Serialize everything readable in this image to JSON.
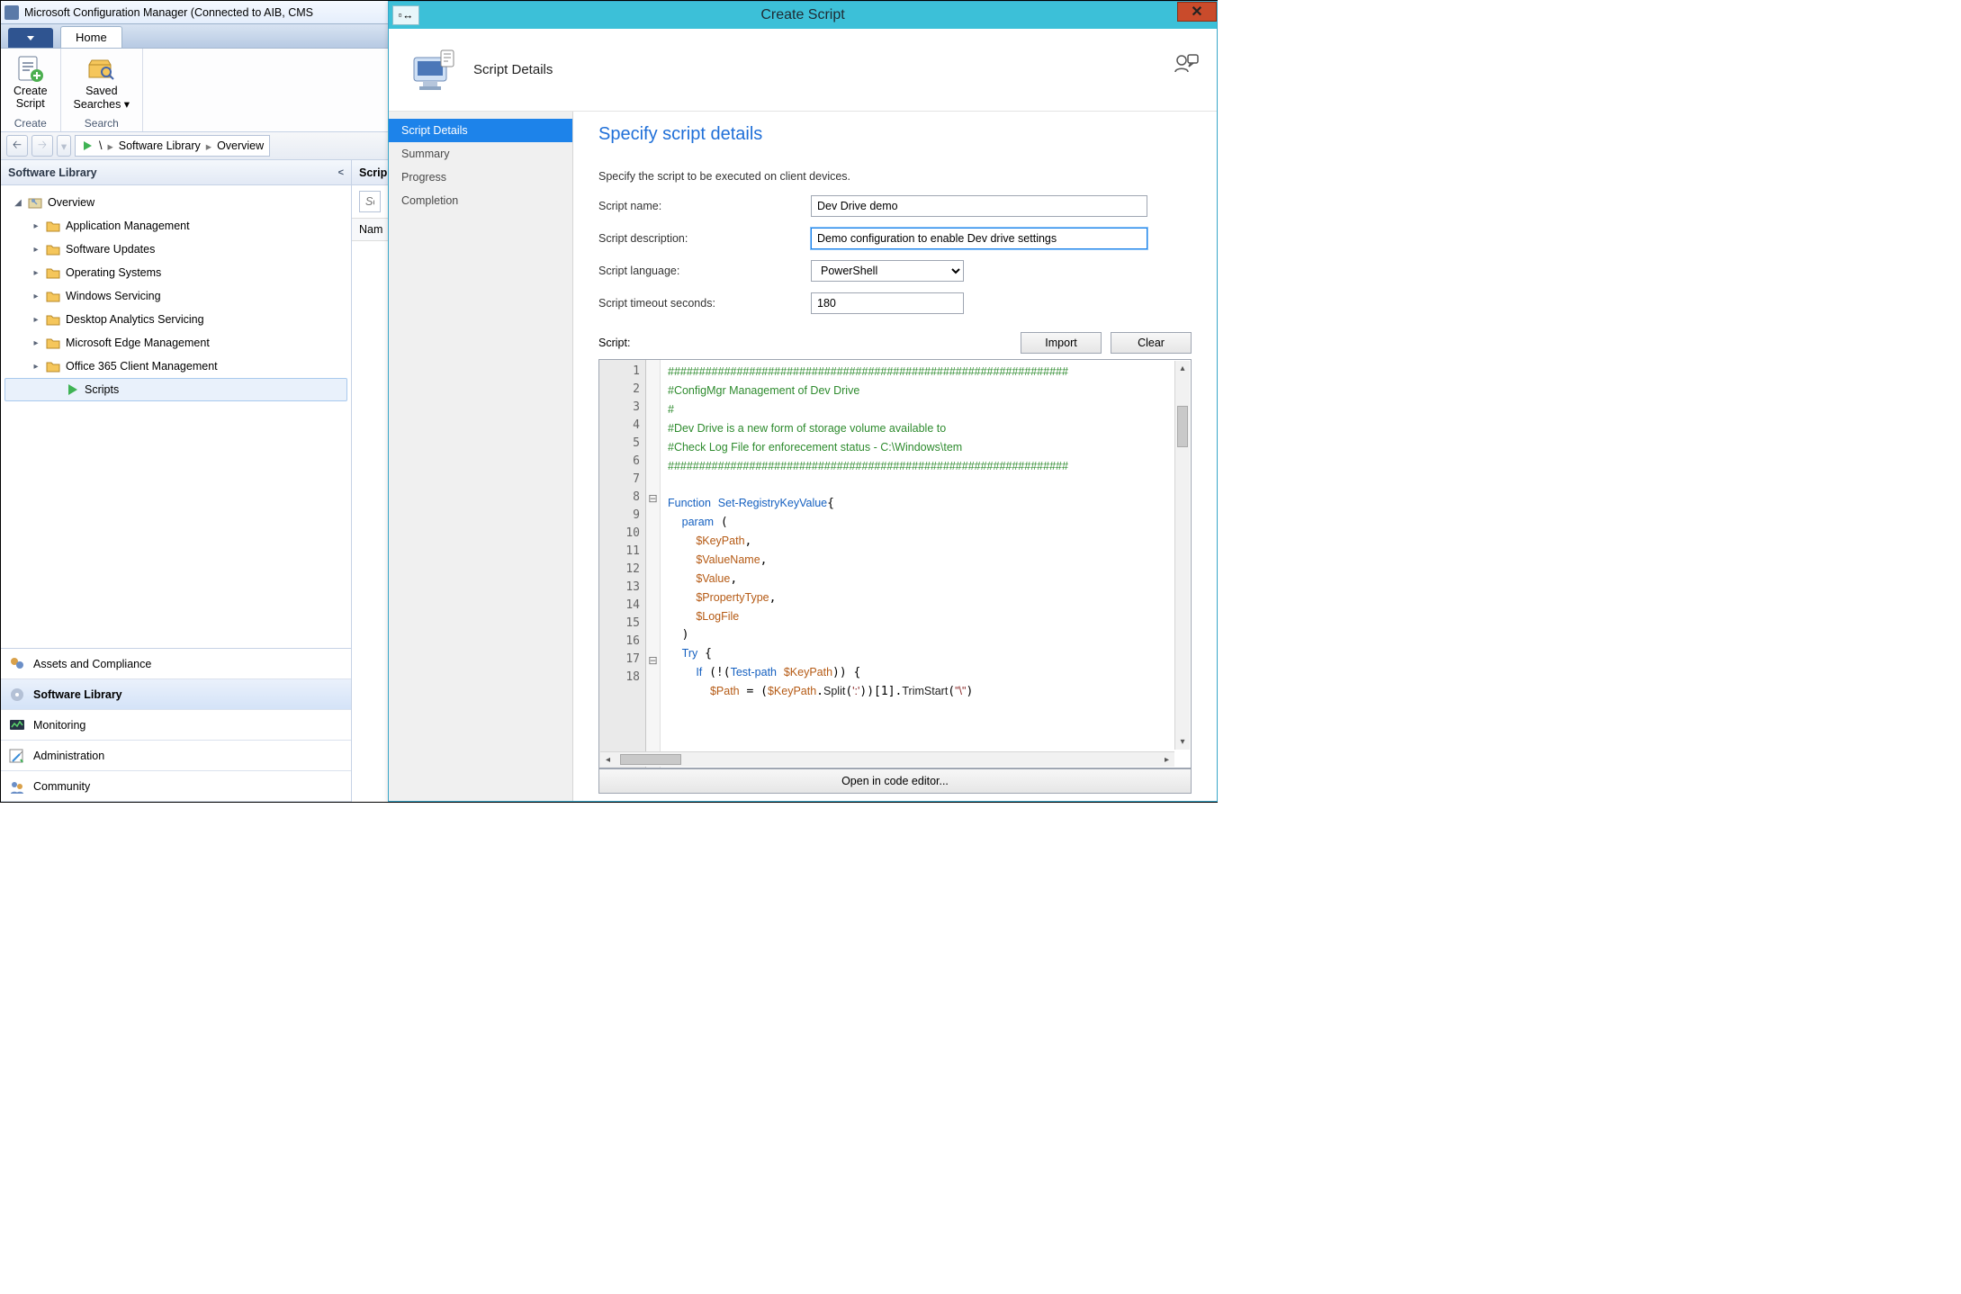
{
  "window": {
    "title": "Microsoft Configuration Manager (Connected to AIB, CMS"
  },
  "ribbon": {
    "home_tab": "Home",
    "create_script": "Create\nScript",
    "saved_searches": "Saved\nSearches ▾",
    "group_create": "Create",
    "group_search": "Search"
  },
  "breadcrumb": {
    "root": "\\",
    "items": [
      "Software Library",
      "Overview"
    ]
  },
  "left": {
    "panel_title": "Software Library",
    "tree": {
      "overview": "Overview",
      "app_mgmt": "Application Management",
      "sw_updates": "Software Updates",
      "os": "Operating Systems",
      "win_servicing": "Windows Servicing",
      "desktop_analytics": "Desktop Analytics Servicing",
      "edge_mgmt": "Microsoft Edge Management",
      "o365": "Office 365 Client Management",
      "scripts": "Scripts"
    },
    "nav": {
      "assets": "Assets and Compliance",
      "library": "Software Library",
      "monitoring": "Monitoring",
      "admin": "Administration",
      "community": "Community"
    }
  },
  "center": {
    "column_scripts": "Scrip",
    "search_placeholder": "Sea",
    "list_header_name": "Nam"
  },
  "dialog": {
    "title": "Create Script",
    "header": "Script Details",
    "steps": {
      "details": "Script Details",
      "summary": "Summary",
      "progress": "Progress",
      "completion": "Completion"
    },
    "heading": "Specify script details",
    "helper": "Specify the script to be executed on client devices.",
    "labels": {
      "name": "Script name:",
      "desc": "Script description:",
      "lang": "Script language:",
      "timeout": "Script timeout seconds:",
      "script": "Script:"
    },
    "values": {
      "name": "Dev Drive demo",
      "desc": "Demo configuration to enable Dev drive settings",
      "lang": "PowerShell",
      "timeout": "180"
    },
    "buttons": {
      "import": "Import",
      "clear": "Clear",
      "open_editor": "Open in code editor..."
    },
    "code_lines": [
      "################################################################",
      "#ConfigMgr Management of Dev Drive",
      "#",
      "#Dev Drive is a new form of storage volume available to",
      "#Check Log File for enforecement status - C:\\Windows\\tem",
      "################################################################",
      "",
      "Function Set-RegistryKeyValue{",
      "  param (",
      "    $KeyPath,",
      "    $ValueName,",
      "    $Value,",
      "    $PropertyType,",
      "    $LogFile",
      "  )",
      "  Try {",
      "    If (!(Test-path $KeyPath)) {",
      "      $Path = ($KeyPath.Split(':'))[1].TrimStart(\"\\\")"
    ]
  }
}
